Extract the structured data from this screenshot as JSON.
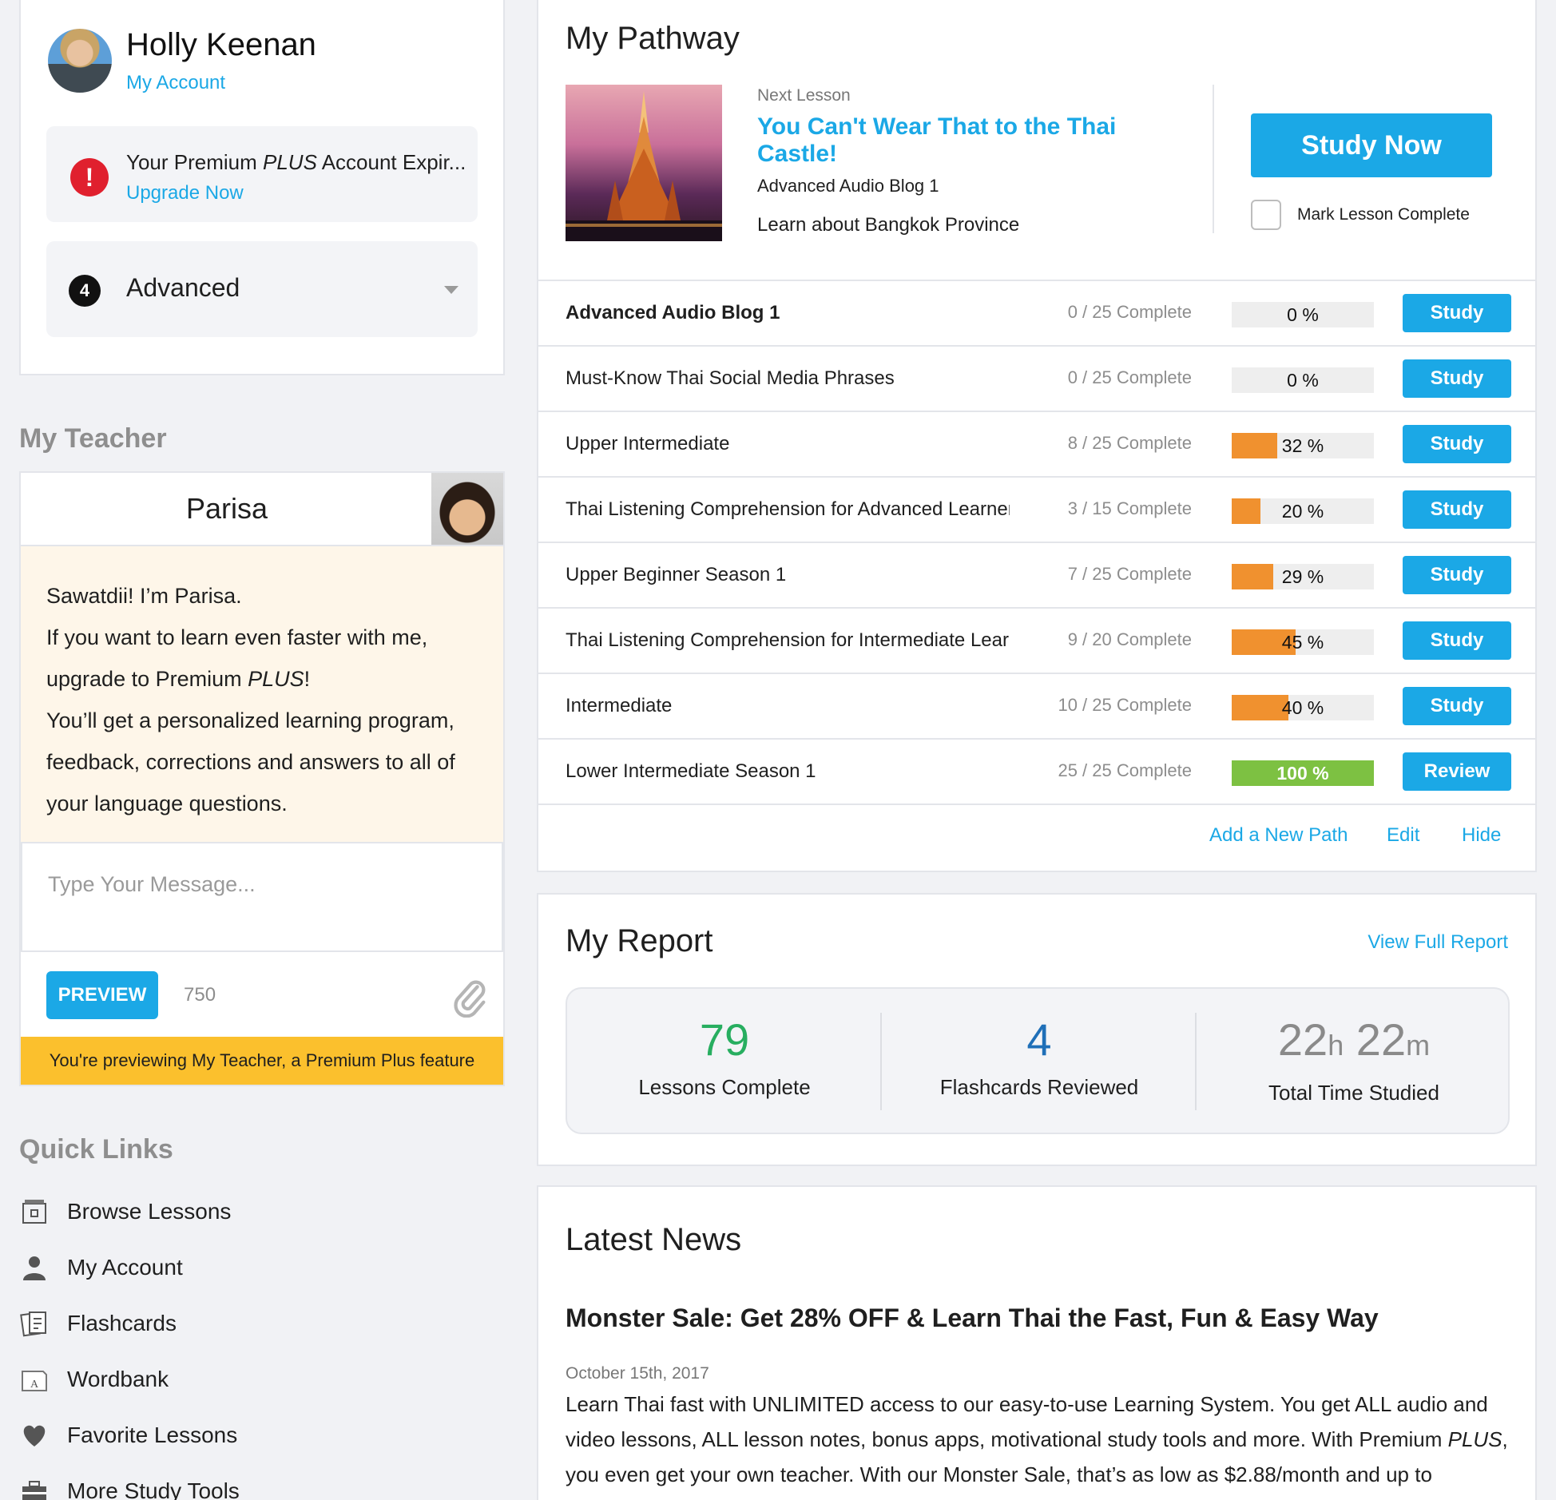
{
  "profile": {
    "name": "Holly Keenan",
    "account_link": "My Account",
    "alert_text_prefix": "Your Premium ",
    "alert_text_plus": "PLUS",
    "alert_text_suffix": " Account Expir...",
    "alert_link": "Upgrade Now",
    "level_number": "4",
    "level_label": "Advanced"
  },
  "teacher": {
    "heading": "My Teacher",
    "name": "Parisa",
    "message_line1": "Sawatdii! I’m Parisa.",
    "message_line2": "If you want to learn even faster with me, upgrade to Premium ",
    "message_plus": "PLUS",
    "message_line2_end": "!",
    "message_line3": "You’ll get a personalized learning program, feedback, corrections and answers to all of your language questions.",
    "input_placeholder": "Type Your Message...",
    "preview_label": "PREVIEW",
    "char_count": "750",
    "banner": "You're previewing My Teacher, a Premium Plus feature"
  },
  "quick_links": {
    "heading": "Quick Links",
    "items": [
      {
        "label": "Browse Lessons",
        "icon": "browse-lessons-icon"
      },
      {
        "label": "My Account",
        "icon": "user-icon"
      },
      {
        "label": "Flashcards",
        "icon": "flashcards-icon"
      },
      {
        "label": "Wordbank",
        "icon": "wordbank-icon"
      },
      {
        "label": "Favorite Lessons",
        "icon": "heart-icon"
      },
      {
        "label": "More Study Tools",
        "icon": "toolbox-icon"
      }
    ]
  },
  "pathway": {
    "title": "My Pathway",
    "next_label": "Next Lesson",
    "next_title": "You Can't Wear That to the Thai Castle!",
    "next_series": "Advanced Audio Blog 1",
    "next_desc": "Learn about Bangkok Province",
    "study_now": "Study Now",
    "mark_complete": "Mark Lesson Complete",
    "rows": [
      {
        "name": "Advanced Audio Blog 1",
        "count": "0 / 25 Complete",
        "percent": 0,
        "percent_label": "0 %",
        "button": "Study",
        "current": true
      },
      {
        "name": "Must-Know Thai Social Media Phrases",
        "count": "0 / 25 Complete",
        "percent": 0,
        "percent_label": "0 %",
        "button": "Study",
        "current": false
      },
      {
        "name": "Upper Intermediate",
        "count": "8 / 25 Complete",
        "percent": 32,
        "percent_label": "32 %",
        "button": "Study",
        "current": false
      },
      {
        "name": "Thai Listening Comprehension for Advanced Learners",
        "count": "3 / 15 Complete",
        "percent": 20,
        "percent_label": "20 %",
        "button": "Study",
        "current": false
      },
      {
        "name": "Upper Beginner Season 1",
        "count": "7 / 25 Complete",
        "percent": 29,
        "percent_label": "29 %",
        "button": "Study",
        "current": false
      },
      {
        "name": "Thai Listening Comprehension for Intermediate Learners",
        "count": "9 / 20 Complete",
        "percent": 45,
        "percent_label": "45 %",
        "button": "Study",
        "current": false
      },
      {
        "name": "Intermediate",
        "count": "10 / 25 Complete",
        "percent": 40,
        "percent_label": "40 %",
        "button": "Study",
        "current": false
      },
      {
        "name": "Lower Intermediate Season 1",
        "count": "25 / 25 Complete",
        "percent": 100,
        "percent_label": "100 %",
        "button": "Review",
        "current": false
      }
    ],
    "footer": {
      "add": "Add a New Path",
      "edit": "Edit",
      "hide": "Hide"
    }
  },
  "report": {
    "title": "My Report",
    "view_full": "View Full Report",
    "lessons_value": "79",
    "lessons_label": "Lessons Complete",
    "flashcards_value": "4",
    "flashcards_label": "Flashcards Reviewed",
    "time_hours": "22",
    "time_h_unit": "h",
    "time_minutes": "22",
    "time_m_unit": "m",
    "time_label": "Total Time Studied"
  },
  "news": {
    "title": "Latest News",
    "headline": "Monster Sale: Get 28% OFF & Learn Thai the Fast, Fun & Easy Way",
    "date": "October 15th, 2017",
    "body_start": "Learn Thai fast with UNLIMITED access to our easy-to-use Learning System. You get ALL audio and video lessons, ALL lesson notes, bonus apps, motivational study tools and more. With Premium ",
    "body_plus": "PLUS",
    "body_end": ", you even get your own teacher. With our Monster Sale, that’s as low as $2.88/month and up to"
  },
  "colors": {
    "accent": "#1ba8e6",
    "progress": "#f0912f",
    "complete": "#7dc142",
    "alert": "#e0202e",
    "banner": "#fbc02d",
    "lessons_stat": "#27ae60",
    "flashcards_stat": "#1f6fb8",
    "time_stat": "#8a8a8a"
  }
}
